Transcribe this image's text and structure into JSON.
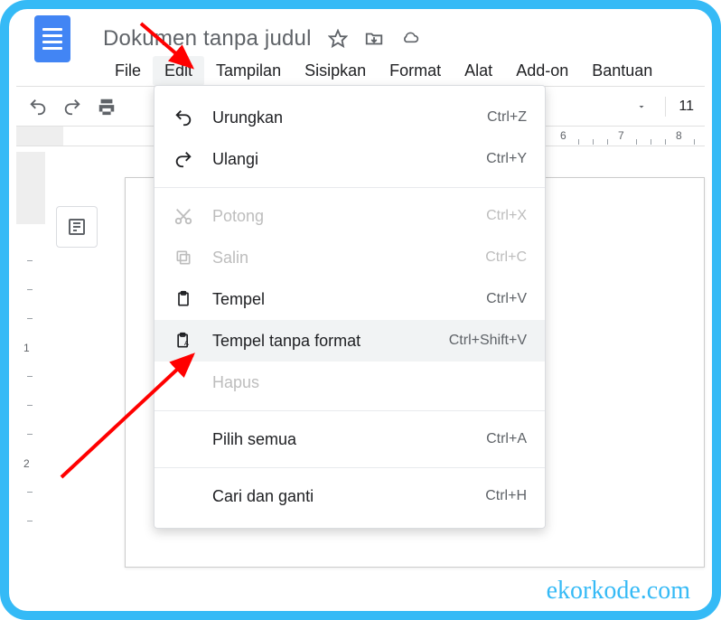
{
  "doc_title": "Dokumen tanpa judul",
  "menubar": {
    "items": [
      "File",
      "Edit",
      "Tampilan",
      "Sisipkan",
      "Format",
      "Alat",
      "Add-on",
      "Bantuan"
    ],
    "active_index": 1
  },
  "toolbar": {
    "font_size": "11"
  },
  "ruler": {
    "numbers": [
      "6",
      "7",
      "8"
    ]
  },
  "edit_menu": {
    "items": [
      {
        "icon": "undo",
        "label": "Urungkan",
        "shortcut": "Ctrl+Z",
        "enabled": true
      },
      {
        "icon": "redo",
        "label": "Ulangi",
        "shortcut": "Ctrl+Y",
        "enabled": true
      },
      {
        "divider": true
      },
      {
        "icon": "cut",
        "label": "Potong",
        "shortcut": "Ctrl+X",
        "enabled": false
      },
      {
        "icon": "copy",
        "label": "Salin",
        "shortcut": "Ctrl+C",
        "enabled": false
      },
      {
        "icon": "paste",
        "label": "Tempel",
        "shortcut": "Ctrl+V",
        "enabled": true
      },
      {
        "icon": "paste-plain",
        "label": "Tempel tanpa format",
        "shortcut": "Ctrl+Shift+V",
        "enabled": true,
        "highlight": true
      },
      {
        "icon": "",
        "label": "Hapus",
        "shortcut": "",
        "enabled": false
      },
      {
        "divider": true
      },
      {
        "icon": "",
        "label": "Pilih semua",
        "shortcut": "Ctrl+A",
        "enabled": true
      },
      {
        "divider": true
      },
      {
        "icon": "",
        "label": "Cari dan ganti",
        "shortcut": "Ctrl+H",
        "enabled": true
      }
    ]
  },
  "watermark": "ekorkode.com"
}
